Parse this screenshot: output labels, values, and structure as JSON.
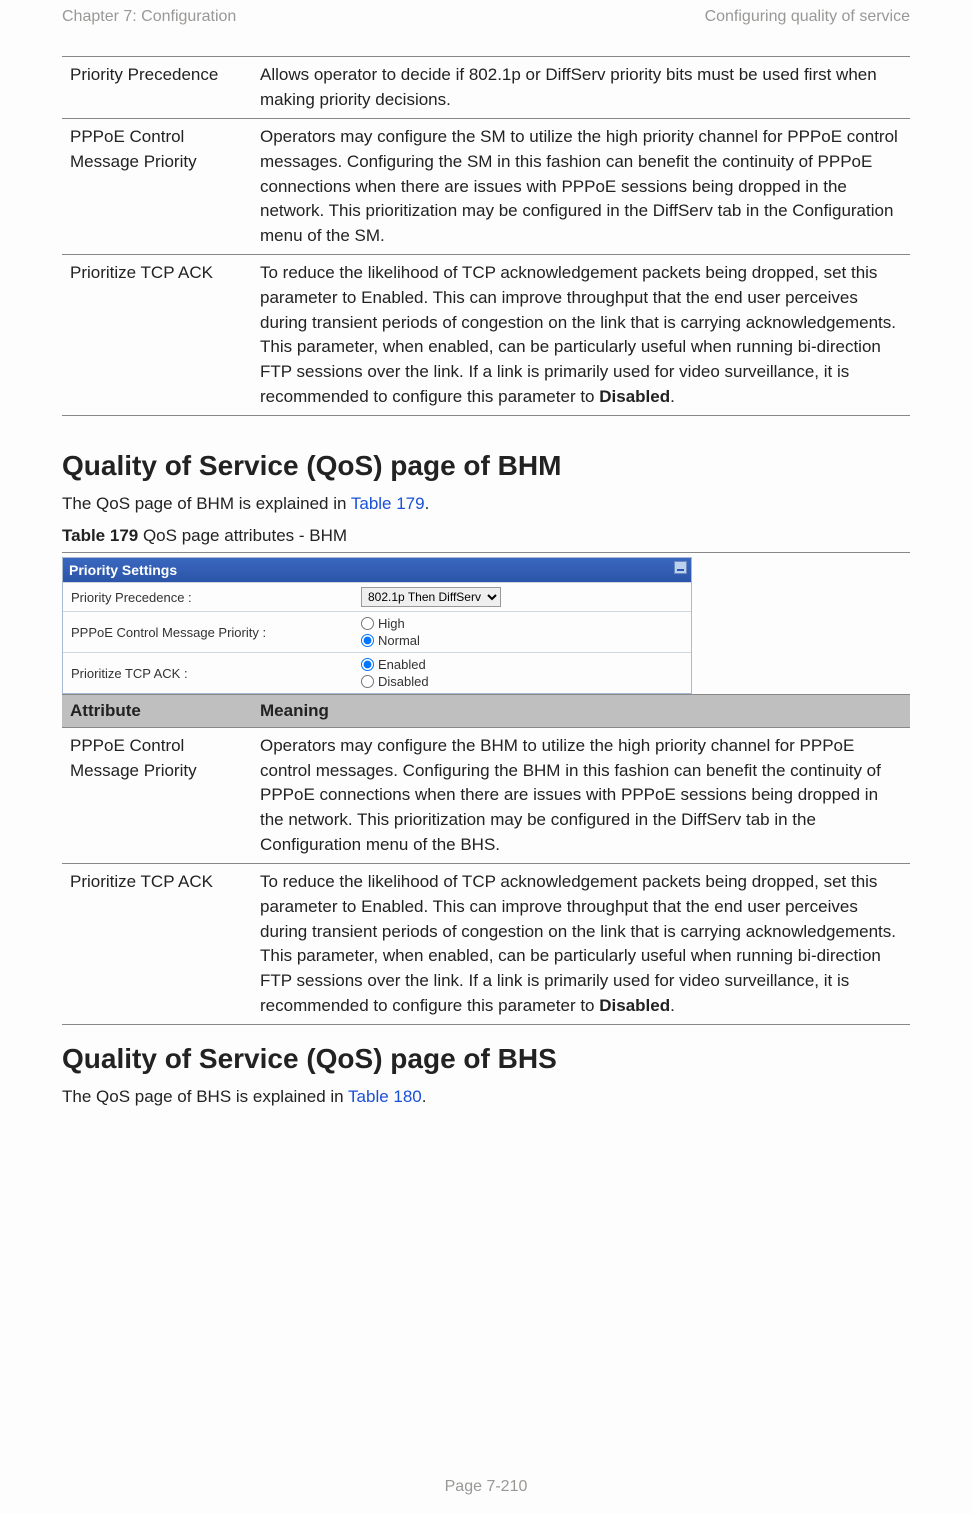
{
  "header": {
    "left": "Chapter 7:  Configuration",
    "right": "Configuring quality of service"
  },
  "table1": {
    "rows": [
      {
        "attr": "Priority Precedence",
        "meaning": "Allows operator to decide if 802.1p or DiffServ priority bits must be used first when making priority decisions."
      },
      {
        "attr": "PPPoE Control Message Priority",
        "meaning": "Operators may configure the SM to utilize the high priority channel for PPPoE control messages. Configuring the SM in this fashion can benefit the continuity of PPPoE connections when there are issues with PPPoE sessions being dropped in the network. This prioritization may be configured in the DiffServ tab in the Configuration menu of the SM."
      },
      {
        "attr": "Prioritize TCP ACK",
        "meaning_pre": "To reduce the likelihood of TCP acknowledgement packets being dropped, set this parameter to Enabled. This can improve throughput that the end user perceives during transient periods of congestion on the link that is carrying acknowledgements. This parameter, when enabled, can be particularly useful when running bi-direction FTP sessions over the link. If a link is primarily used for video surveillance, it is recommended to configure this parameter to ",
        "meaning_bold": "Disabled",
        "meaning_post": "."
      }
    ]
  },
  "section_bhm": {
    "heading": "Quality of Service (QoS) page of BHM",
    "intro_pre": "The QoS page of BHM is explained in ",
    "intro_link": "Table 179",
    "intro_post": ".",
    "caption_bold": "Table 179",
    "caption_rest": " QoS page attributes - BHM"
  },
  "panel": {
    "title": "Priority Settings",
    "rows": {
      "precedence": {
        "label": "Priority Precedence :",
        "selected": "802.1p Then DiffServ"
      },
      "pppoe": {
        "label": "PPPoE Control Message Priority :",
        "opt_high": "High",
        "opt_normal": "Normal",
        "selected": "Normal"
      },
      "tcpack": {
        "label": "Prioritize TCP ACK :",
        "opt_enabled": "Enabled",
        "opt_disabled": "Disabled",
        "selected": "Enabled"
      }
    }
  },
  "table2": {
    "head_attr": "Attribute",
    "head_meaning": "Meaning",
    "rows": [
      {
        "attr": "PPPoE Control Message Priority",
        "meaning": "Operators may configure the BHM to utilize the high priority channel for PPPoE control messages. Configuring the BHM in this fashion can benefit the continuity of PPPoE connections when there are issues with PPPoE sessions being dropped in the network. This prioritization may be configured in the DiffServ tab in the Configuration menu of the BHS."
      },
      {
        "attr": "Prioritize TCP ACK",
        "meaning_pre": "To reduce the likelihood of TCP acknowledgement packets being dropped, set this parameter to Enabled. This can improve throughput that the end user perceives during transient periods of congestion on the link that is carrying acknowledgements. This parameter, when enabled, can be particularly useful when running bi-direction FTP sessions over the link. If a link is primarily used for video surveillance, it is recommended to configure this parameter to ",
        "meaning_bold": "Disabled",
        "meaning_post": "."
      }
    ]
  },
  "section_bhs": {
    "heading": "Quality of Service (QoS) page of BHS",
    "intro_pre": "The QoS page of BHS is explained in ",
    "intro_link": "Table 180",
    "intro_post": "."
  },
  "footer": "Page 7-210"
}
